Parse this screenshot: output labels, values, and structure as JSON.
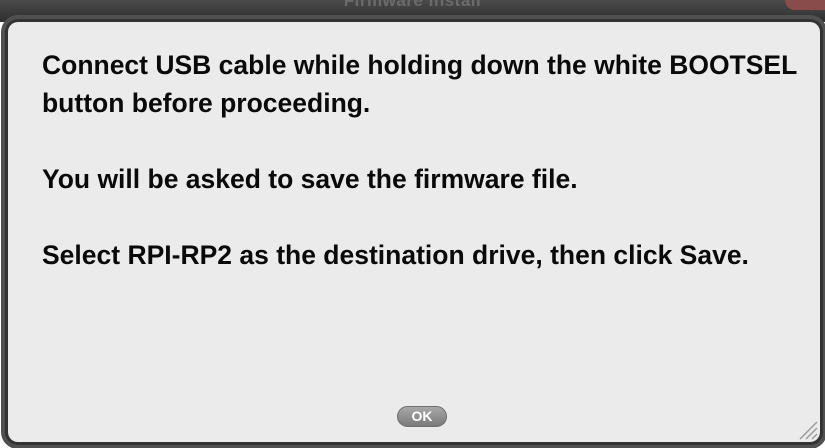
{
  "window": {
    "title": "Firmware Install"
  },
  "dialog": {
    "message_paragraphs": [
      "Connect USB cable while holding down the white BOOTSEL button before proceeding.",
      "You will be asked to save the firmware file.",
      "Select RPI-RP2 as the destination drive, then click Save."
    ],
    "ok_label": "OK"
  },
  "icons": {
    "resize_grip": "resize-grip-icon"
  },
  "colors": {
    "dialog_background": "#ebebeb",
    "dialog_border": "#333333",
    "text": "#0a0a0a",
    "ok_button": "#8c8c8c"
  }
}
